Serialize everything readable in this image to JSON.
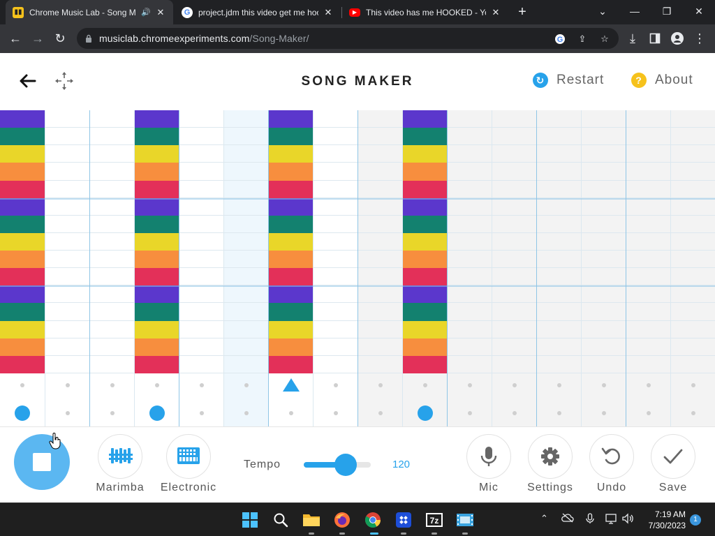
{
  "browser": {
    "tabs": [
      {
        "title": "Chrome Music Lab - Song M",
        "favicon": "chrome-music-lab-favicon",
        "active": true,
        "audio": true
      },
      {
        "title": "project.jdm this video get me hoo",
        "favicon": "google-favicon",
        "active": false
      },
      {
        "title": "This video has me HOOKED - You",
        "favicon": "youtube-favicon",
        "active": false
      }
    ],
    "address": {
      "host": "musiclab.chromeexperiments.com",
      "path": "/Song-Maker/"
    }
  },
  "app": {
    "title": "SONG MAKER",
    "restart_label": "Restart",
    "about_label": "About",
    "about_symbol": "?"
  },
  "grid": {
    "columns": 16,
    "melody_rows": 15,
    "filled_columns": [
      0,
      3,
      6,
      9
    ],
    "highlight_column": 5,
    "shaded_from_column": 8,
    "row_colors": [
      "#5b37cc",
      "#13816f",
      "#e9d629",
      "#f78e3e",
      "#e33059"
    ]
  },
  "percussion": {
    "upper_triangle_columns": [
      6
    ],
    "lower_circle_columns": [
      0,
      3,
      9
    ]
  },
  "controls": {
    "play_state": "playing",
    "instruments": [
      {
        "label": "Marimba",
        "icon": "marimba-icon"
      },
      {
        "label": "Electronic",
        "icon": "electronic-icon"
      }
    ],
    "tempo_label": "Tempo",
    "tempo_value": "120",
    "tempo_fraction": 0.62,
    "actions": [
      {
        "label": "Mic",
        "icon": "mic-icon"
      },
      {
        "label": "Settings",
        "icon": "gear-icon"
      },
      {
        "label": "Undo",
        "icon": "undo-icon"
      },
      {
        "label": "Save",
        "icon": "check-icon"
      }
    ]
  },
  "taskbar": {
    "time": "7:19 AM",
    "date": "7/30/2023",
    "notification_count": "1"
  },
  "colors": {
    "accent": "#27a2ea",
    "play_button": "#5bb7f1",
    "about_yellow": "#f6c21c",
    "restart_blue": "#27a2ea"
  }
}
